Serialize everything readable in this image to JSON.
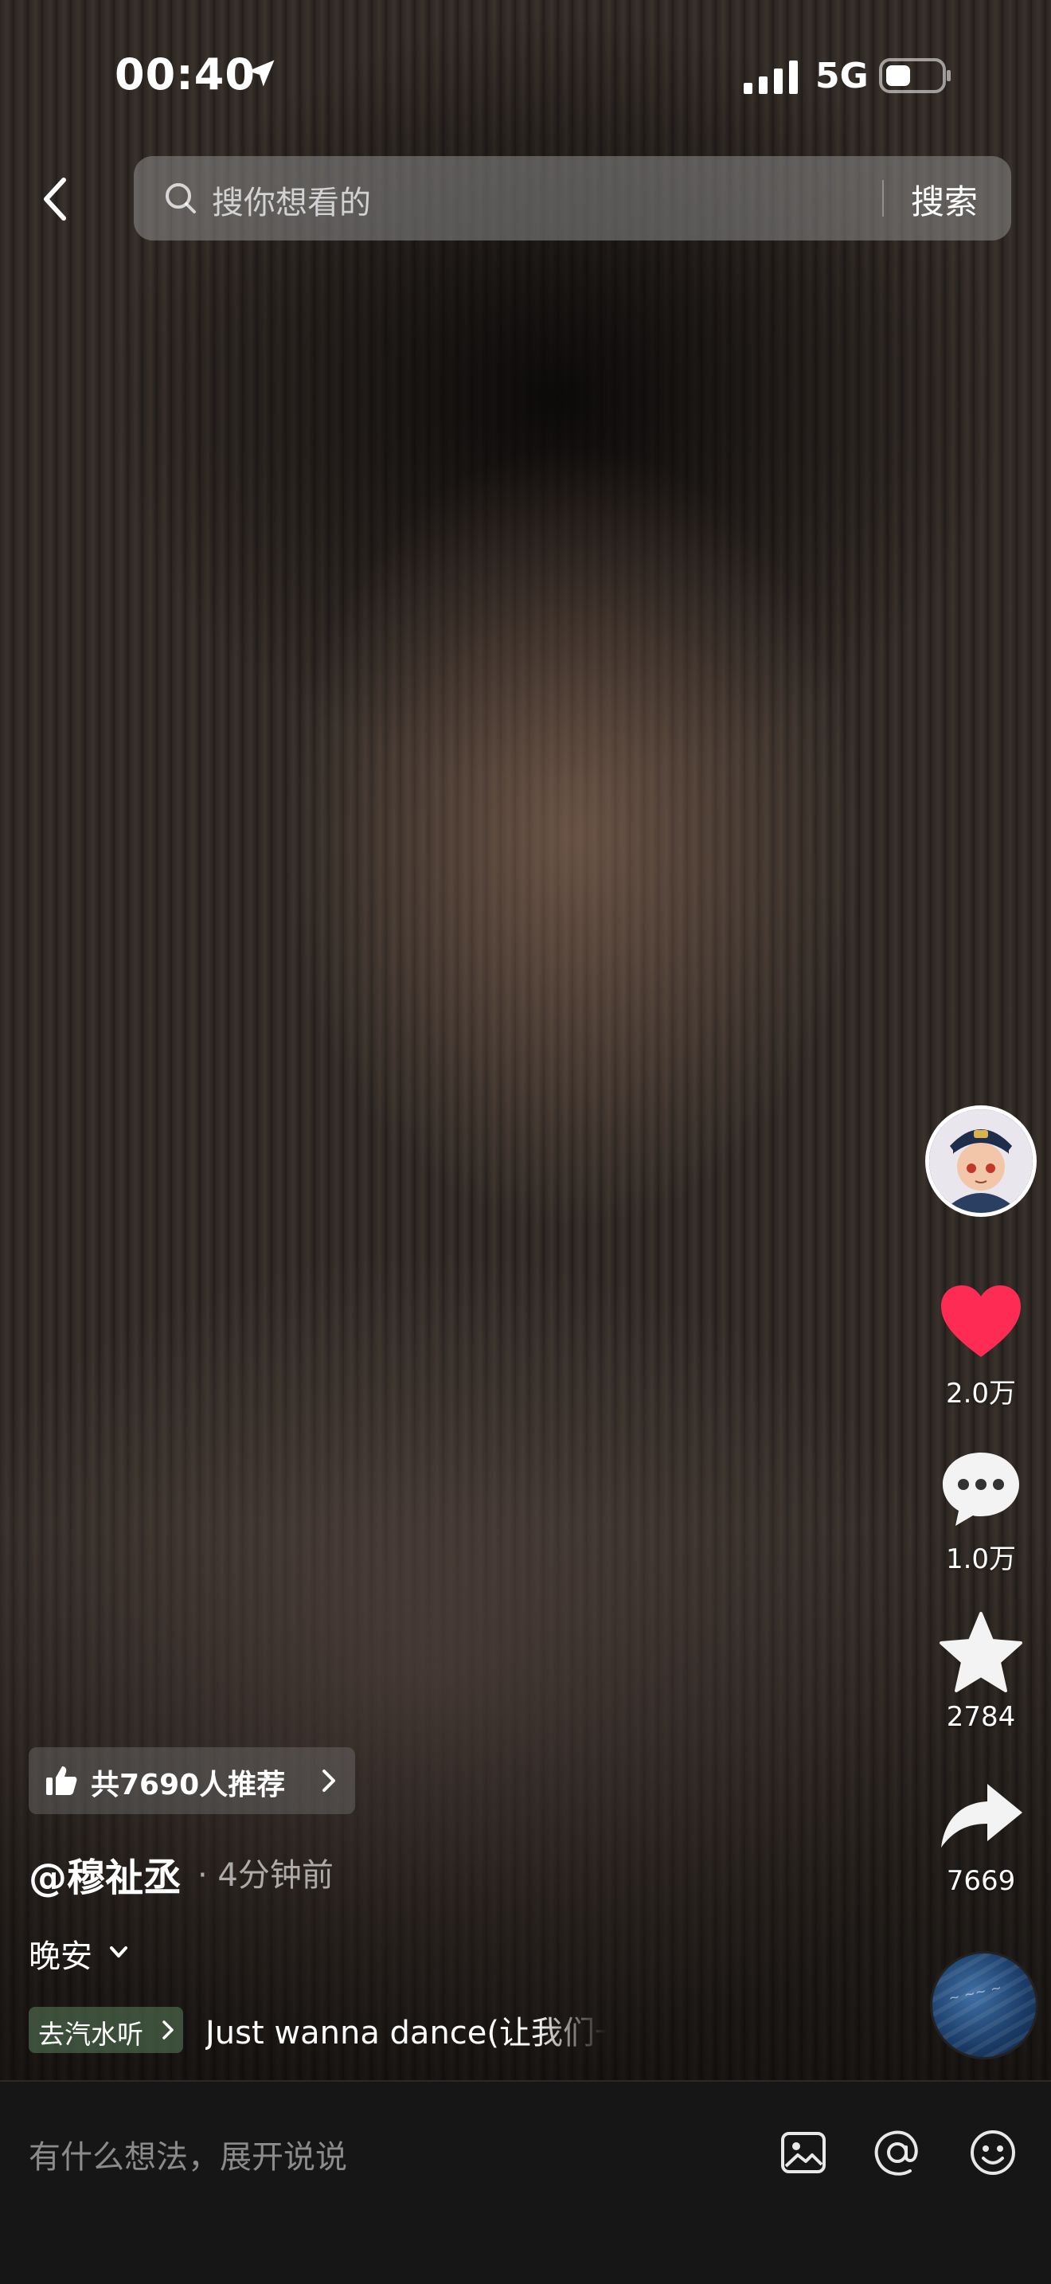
{
  "status_bar": {
    "time": "00:40",
    "network": "5G",
    "icons": [
      "location-arrow-icon",
      "signal-bars-icon",
      "battery-icon"
    ]
  },
  "top_bar": {
    "back_icon": "chevron-left-icon",
    "search": {
      "placeholder": "搜你想看的",
      "button_label": "搜索",
      "icon": "search-icon"
    }
  },
  "right_rail": {
    "avatar_icon": "creator-avatar",
    "like": {
      "icon": "heart-icon",
      "count": "2.0万",
      "color": "#fe2c55"
    },
    "comment": {
      "icon": "comment-bubble-icon",
      "count": "1.0万"
    },
    "favorite": {
      "icon": "star-icon",
      "count": "2784"
    },
    "share": {
      "icon": "share-arrow-icon",
      "count": "7669"
    },
    "music_disc_icon": "music-disc"
  },
  "video_info": {
    "recommend": {
      "icon": "thumbs-up-icon",
      "label": "共7690人推荐"
    },
    "author": "@穆祉丞",
    "post_time": "· 4分钟前",
    "caption": "晚安",
    "music": {
      "chip_label": "去汽水听",
      "chip_color": "#4f6e50",
      "title": "Just wanna dance(让我们一起跳舞)"
    }
  },
  "comment_bar": {
    "placeholder": "有什么想法，展开说说",
    "icons": [
      "image-icon",
      "at-icon",
      "emoji-icon"
    ]
  }
}
